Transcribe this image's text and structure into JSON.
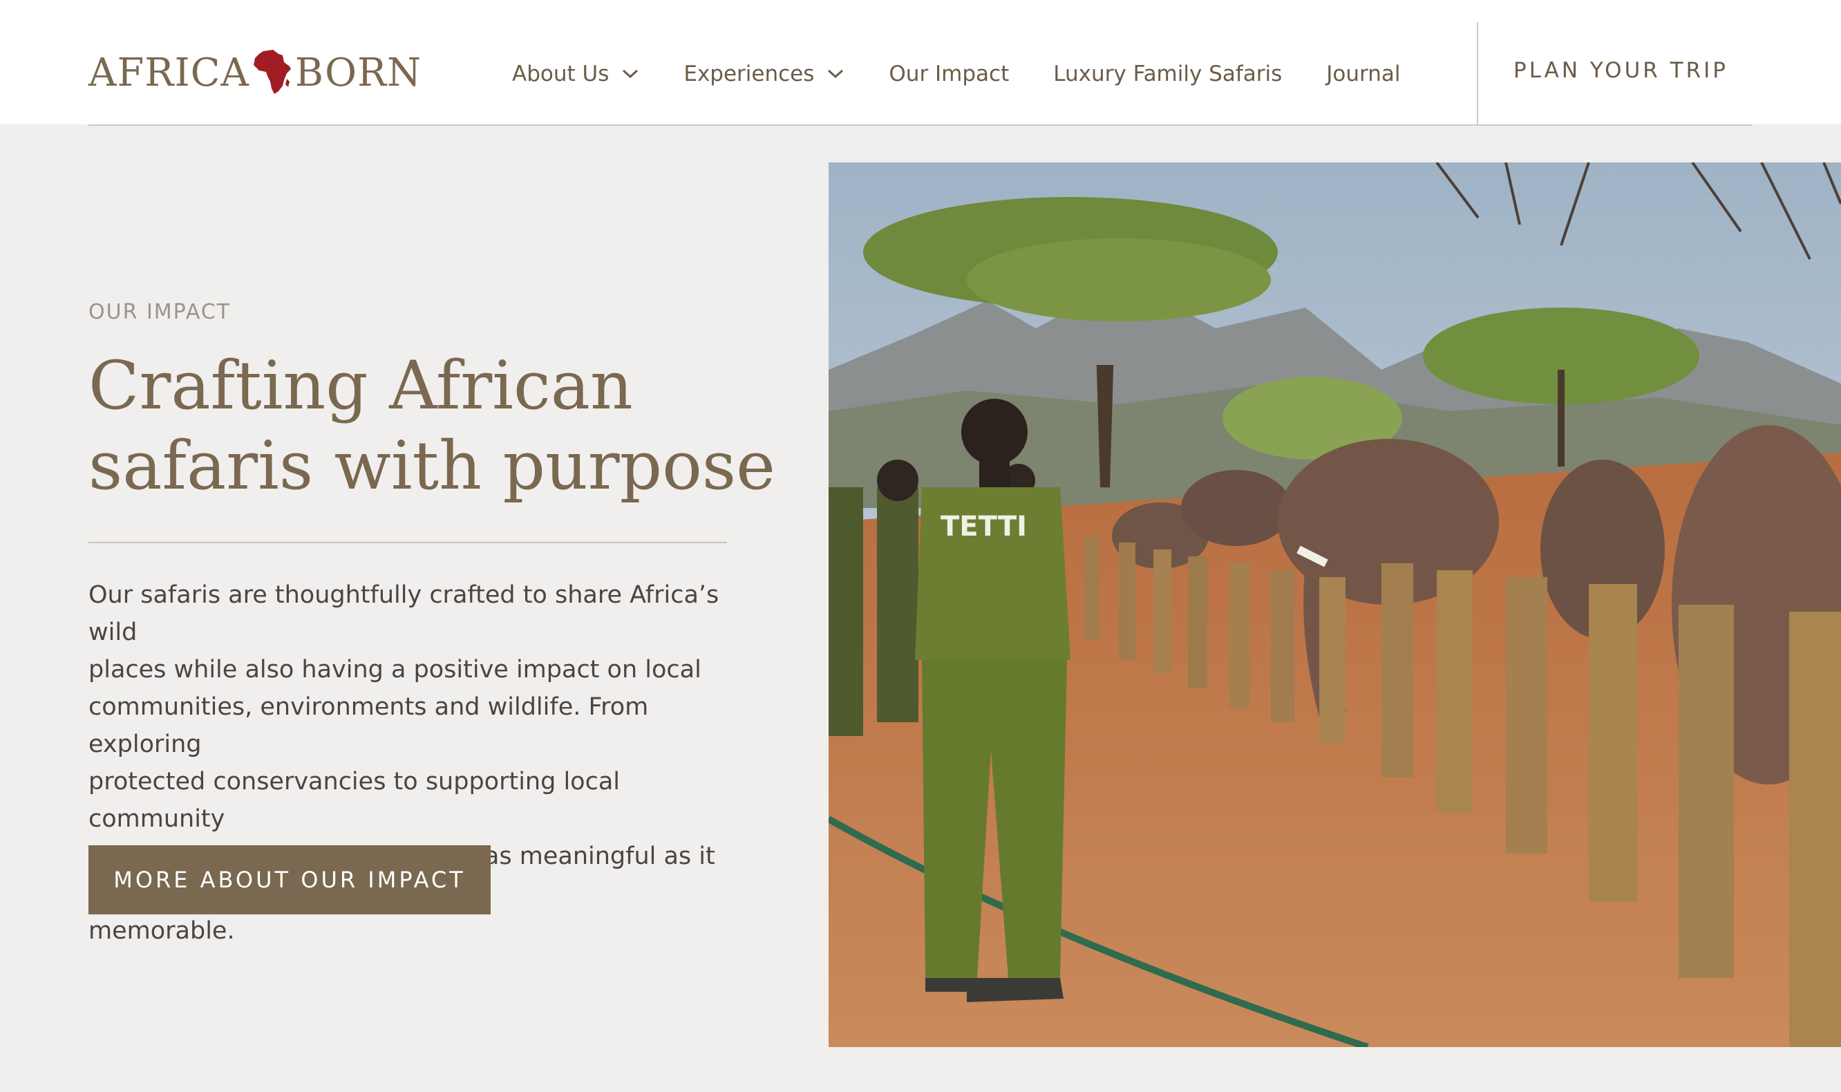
{
  "brand": {
    "name_left": "AFRICA",
    "name_right": "BORN",
    "logo_icon": "africa-map-icon",
    "logo_color": "#a11d23"
  },
  "nav": {
    "items": [
      {
        "label": "About Us",
        "has_dropdown": true
      },
      {
        "label": "Experiences",
        "has_dropdown": true
      },
      {
        "label": "Our Impact",
        "has_dropdown": false
      },
      {
        "label": "Luxury Family Safaris",
        "has_dropdown": false
      },
      {
        "label": "Journal",
        "has_dropdown": false
      }
    ],
    "cta_label": "PLAN YOUR TRIP"
  },
  "hero": {
    "eyebrow": "OUR IMPACT",
    "heading_line1": "Crafting African",
    "heading_line2": "safaris with purpose",
    "body_line1": "Our safaris are thoughtfully crafted to share Africa’s wild",
    "body_line2": "places while also having a positive impact on local",
    "body_line3": "communities, environments and wildlife. From exploring",
    "body_line4": "protected conservancies to supporting local community",
    "body_line5": "initiatives, each safari with us is as meaningful as it is",
    "body_line6": "memorable.",
    "button_label": "MORE ABOUT OUR IMPACT",
    "shirt_text": "TETTI"
  },
  "colors": {
    "accent": "#7a6850",
    "nav_text": "#6b5b47",
    "background": "#f0efed",
    "body_text": "#4a4542",
    "eyebrow_text": "#9a948c"
  }
}
